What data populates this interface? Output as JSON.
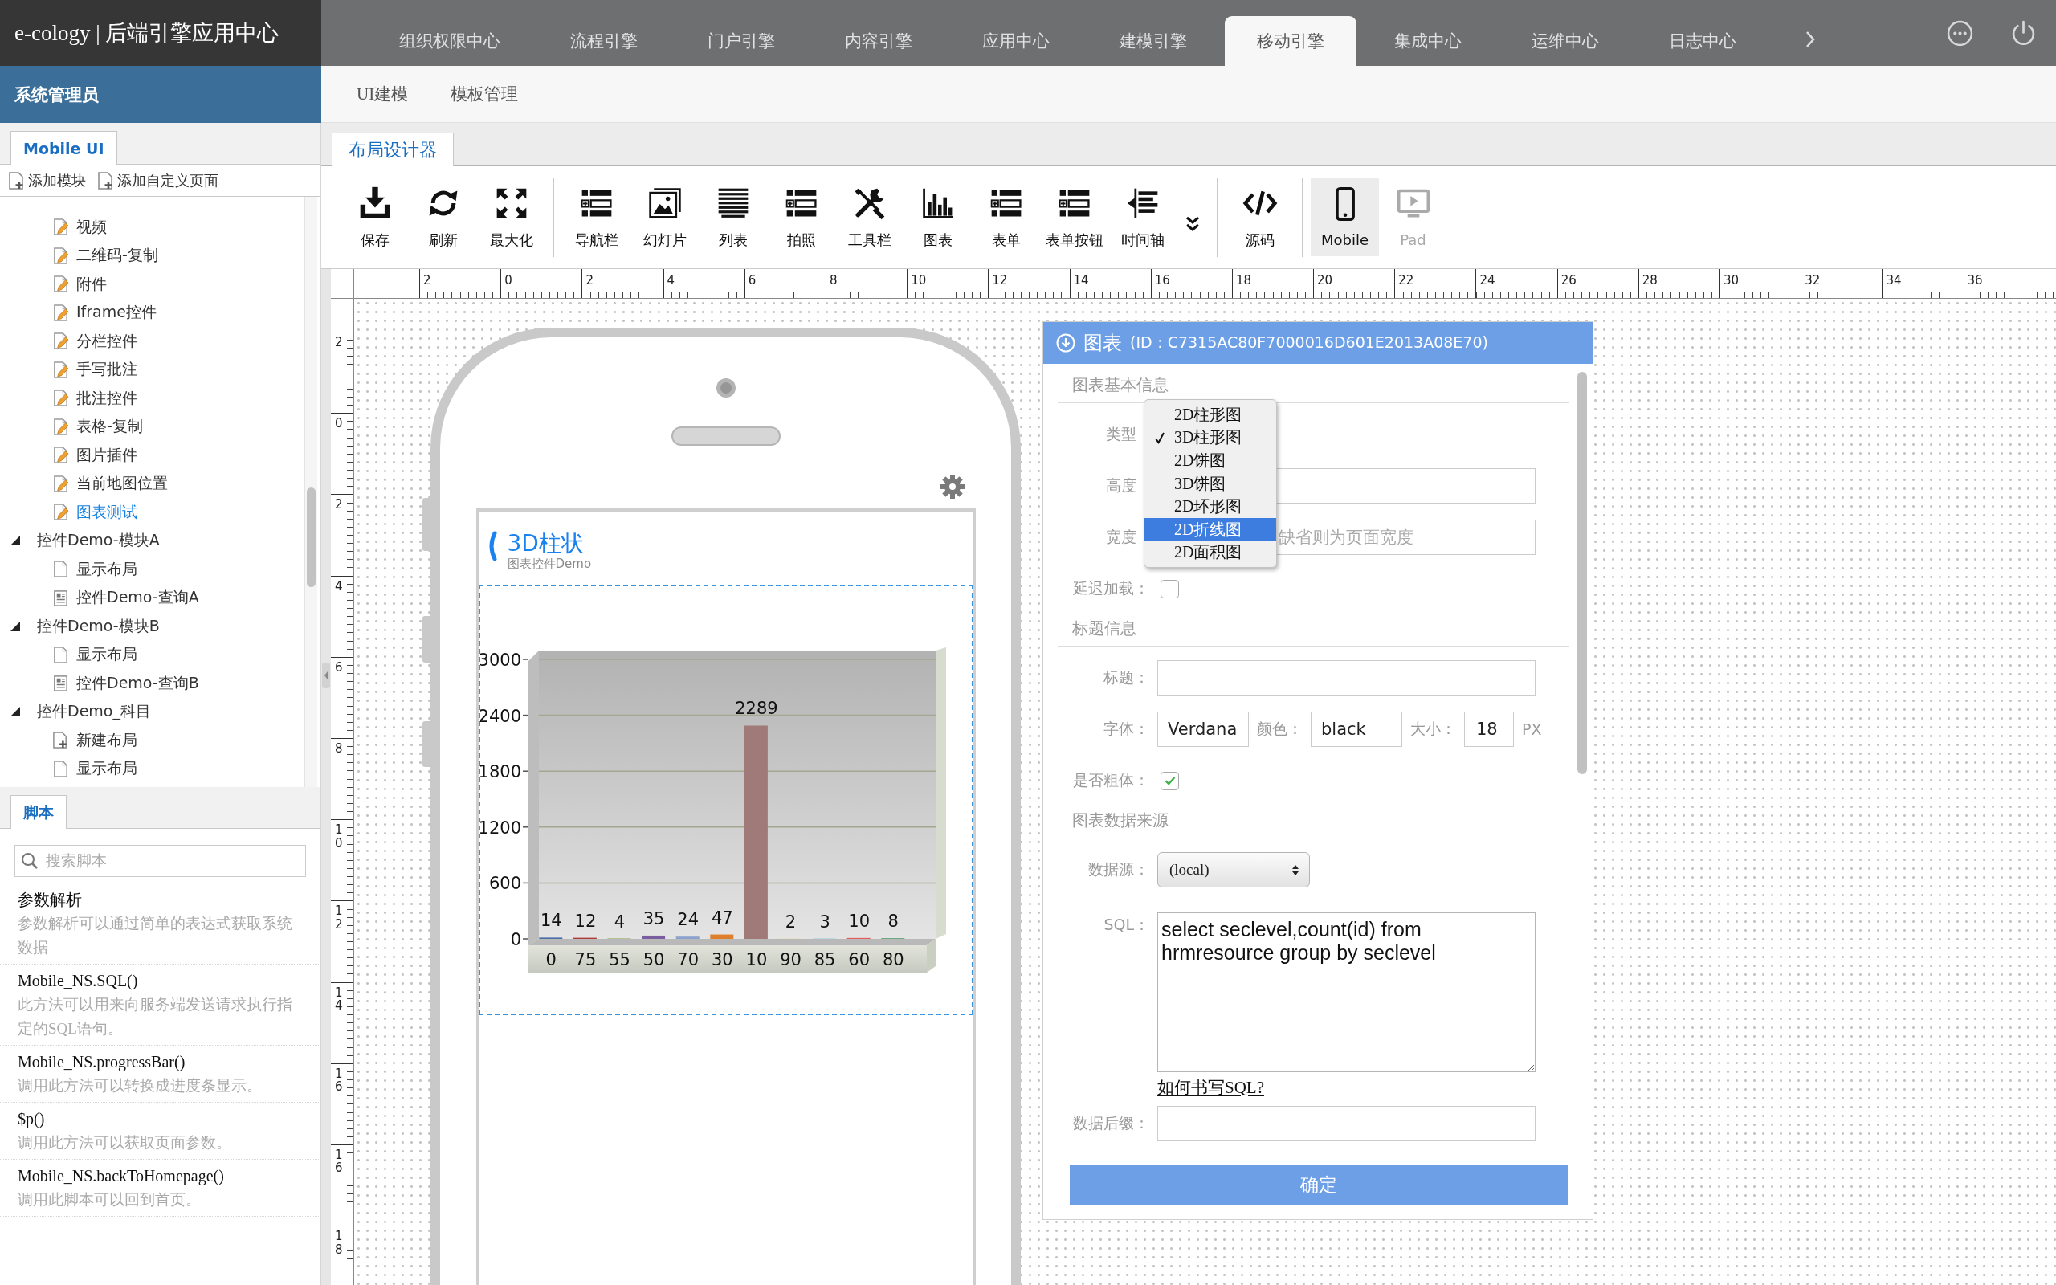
{
  "header": {
    "logo": "e-cology | 后端引擎应用中心",
    "user": "系统管理员"
  },
  "nav": {
    "tabs": [
      {
        "label": "组织权限中心",
        "selected": false
      },
      {
        "label": "流程引擎",
        "selected": false
      },
      {
        "label": "门户引擎",
        "selected": false
      },
      {
        "label": "内容引擎",
        "selected": false
      },
      {
        "label": "应用中心",
        "selected": false
      },
      {
        "label": "建模引擎",
        "selected": false
      },
      {
        "label": "移动引擎",
        "selected": true
      },
      {
        "label": "集成中心",
        "selected": false
      },
      {
        "label": "运维中心",
        "selected": false
      },
      {
        "label": "日志中心",
        "selected": false
      }
    ]
  },
  "subnav": {
    "links": [
      "UI建模",
      "模板管理"
    ]
  },
  "sidebar": {
    "tabs": [
      {
        "label": "Mobile UI",
        "selected": true
      }
    ],
    "actions": [
      "添加模块",
      "添加自定义页面"
    ],
    "tree": [
      {
        "children": [
          {
            "label": "视频",
            "kind": "widget",
            "selected": false
          },
          {
            "label": "二维码-复制",
            "kind": "widget",
            "selected": false
          },
          {
            "label": "附件",
            "kind": "widget",
            "selected": false
          },
          {
            "label": "Iframe控件",
            "kind": "widget",
            "selected": false
          },
          {
            "label": "分栏控件",
            "kind": "widget",
            "selected": false
          },
          {
            "label": "手写批注",
            "kind": "widget",
            "selected": false
          },
          {
            "label": "批注控件",
            "kind": "widget",
            "selected": false
          },
          {
            "label": "表格-复制",
            "kind": "widget",
            "selected": false
          },
          {
            "label": "图片插件",
            "kind": "widget",
            "selected": false
          },
          {
            "label": "当前地图位置",
            "kind": "widget",
            "selected": false
          },
          {
            "label": "图表测试",
            "kind": "widget",
            "selected": true
          }
        ]
      },
      {
        "label": "控件Demo-模块A",
        "kind": "folder",
        "expanded": true,
        "selected": false,
        "children": [
          {
            "label": "显示布局",
            "kind": "layout",
            "selected": false
          },
          {
            "label": "控件Demo-查询A",
            "kind": "query",
            "selected": false
          }
        ]
      },
      {
        "label": "控件Demo-模块B",
        "kind": "folder",
        "expanded": true,
        "selected": false,
        "children": [
          {
            "label": "显示布局",
            "kind": "layout",
            "selected": false
          },
          {
            "label": "控件Demo-查询B",
            "kind": "query",
            "selected": false
          }
        ]
      },
      {
        "label": "控件Demo_科目",
        "kind": "folder",
        "expanded": true,
        "selected": false,
        "children": [
          {
            "label": "新建布局",
            "kind": "new",
            "selected": false
          },
          {
            "label": "显示布局",
            "kind": "layout",
            "selected": false
          }
        ]
      }
    ]
  },
  "scripts": {
    "tabs": [
      {
        "label": "脚本",
        "selected": true
      }
    ],
    "search": {
      "placeholder": "搜索脚本"
    },
    "items": [
      {
        "title": "参数解析",
        "description": "参数解析可以通过简单的表达式获取系统数据"
      },
      {
        "title": "Mobile_NS.SQL()",
        "description": "此方法可以用来向服务端发送请求执行指定的SQL语句。"
      },
      {
        "title": "Mobile_NS.progressBar()",
        "description": "调用此方法可以转换成进度条显示。"
      },
      {
        "title": "$p()",
        "description": "调用此方法可以获取页面参数。"
      },
      {
        "title": "Mobile_NS.backToHomepage()",
        "description": "调用此脚本可以回到首页。"
      }
    ]
  },
  "designer": {
    "tabs": [
      {
        "label": "布局设计器",
        "selected": true
      }
    ],
    "toolbar": {
      "groups": [
        [
          {
            "kind": "tool",
            "label": "保存"
          },
          {
            "kind": "tool",
            "label": "刷新"
          },
          {
            "kind": "tool",
            "label": "最大化"
          }
        ],
        [
          {
            "kind": "tool",
            "label": "导航栏"
          },
          {
            "kind": "tool",
            "label": "幻灯片"
          },
          {
            "kind": "tool",
            "label": "列表"
          },
          {
            "kind": "tool",
            "label": "拍照"
          },
          {
            "kind": "tool",
            "label": "工具栏"
          },
          {
            "kind": "tool",
            "label": "图表"
          },
          {
            "kind": "tool",
            "label": "表单"
          },
          {
            "kind": "tool",
            "label": "表单按钮"
          },
          {
            "kind": "tool",
            "label": "时间轴"
          },
          {
            "kind": "more"
          }
        ],
        [
          {
            "kind": "tool",
            "label": "源码"
          }
        ],
        [
          {
            "kind": "tool",
            "label": "Mobile",
            "selected": true,
            "disabled": false
          },
          {
            "kind": "tool",
            "label": "Pad",
            "selected": false,
            "disabled": true
          }
        ]
      ]
    },
    "ruler": {
      "horizontal": [
        "2",
        "0",
        "2",
        "4",
        "6",
        "8",
        "10",
        "12",
        "14",
        "16",
        "18",
        "20",
        "22",
        "24",
        "26",
        "28",
        "30",
        "32",
        "34",
        "36"
      ],
      "vertical": [
        "2",
        "0",
        "2",
        "4",
        "6",
        "8",
        "10",
        "12",
        "14",
        "16",
        "16",
        "18"
      ]
    },
    "phone": {
      "title": "3D柱状",
      "subtitle": "图表控件Demo",
      "chart_data": {
        "type": "bar",
        "categories": [
          "0",
          "75",
          "55",
          "50",
          "70",
          "30",
          "10",
          "90",
          "85",
          "60",
          "80"
        ],
        "values": [
          14,
          12,
          4,
          35,
          24,
          47,
          2289,
          2,
          3,
          10,
          8
        ],
        "ylim": [
          0,
          3000
        ],
        "yticks": [
          0,
          600,
          1200,
          1800,
          2400,
          3000
        ],
        "grid": true,
        "data_labels": true
      }
    },
    "properties": {
      "title": "图表",
      "id": "(ID：C7315AC80F7000016D601E2013A08E70)",
      "sections": [
        {
          "title": "图表基本信息",
          "rows": [
            {
              "kind": "dropdown",
              "label": "类型",
              "open": true,
              "options": [
                {
                  "label": "2D柱形图",
                  "selected": false,
                  "highlighted": false
                },
                {
                  "label": "3D柱形图",
                  "selected": true,
                  "highlighted": false
                },
                {
                  "label": "2D饼图",
                  "selected": false,
                  "highlighted": false
                },
                {
                  "label": "3D饼图",
                  "selected": false,
                  "highlighted": false
                },
                {
                  "label": "2D环形图",
                  "selected": false,
                  "highlighted": false
                },
                {
                  "label": "2D折线图",
                  "selected": false,
                  "highlighted": true
                },
                {
                  "label": "2D面积图",
                  "selected": false,
                  "highlighted": false
                }
              ]
            },
            {
              "kind": "input",
              "label": "高度"
            },
            {
              "kind": "input",
              "label": "宽度",
              "placeholder": "缺省则为页面宽度"
            },
            {
              "kind": "checkbox",
              "label": "延迟加载：",
              "checked": false
            }
          ]
        },
        {
          "title": "标题信息",
          "rows": [
            {
              "kind": "input",
              "label": "标题："
            },
            {
              "kind": "inline",
              "label": "字体：",
              "parts": [
                {
                  "kind": "input",
                  "value": "Verdana"
                },
                {
                  "kind": "text",
                  "text": "颜色："
                },
                {
                  "kind": "input",
                  "value": "black"
                },
                {
                  "kind": "text",
                  "text": "大小："
                },
                {
                  "kind": "input",
                  "value": "18"
                },
                {
                  "kind": "text",
                  "text": "PX"
                }
              ]
            },
            {
              "kind": "checkbox",
              "label": "是否粗体：",
              "checked": true
            }
          ]
        },
        {
          "title": "图表数据来源",
          "rows": [
            {
              "kind": "select",
              "label": "数据源：",
              "value": "(local)"
            },
            {
              "kind": "textarea",
              "label": "SQL：",
              "value": "select seclevel,count(id) from hrmresource group by seclevel",
              "link": "如何书写SQL?"
            },
            {
              "kind": "input",
              "label": "数据后缀："
            }
          ]
        }
      ],
      "button": "确定"
    }
  }
}
